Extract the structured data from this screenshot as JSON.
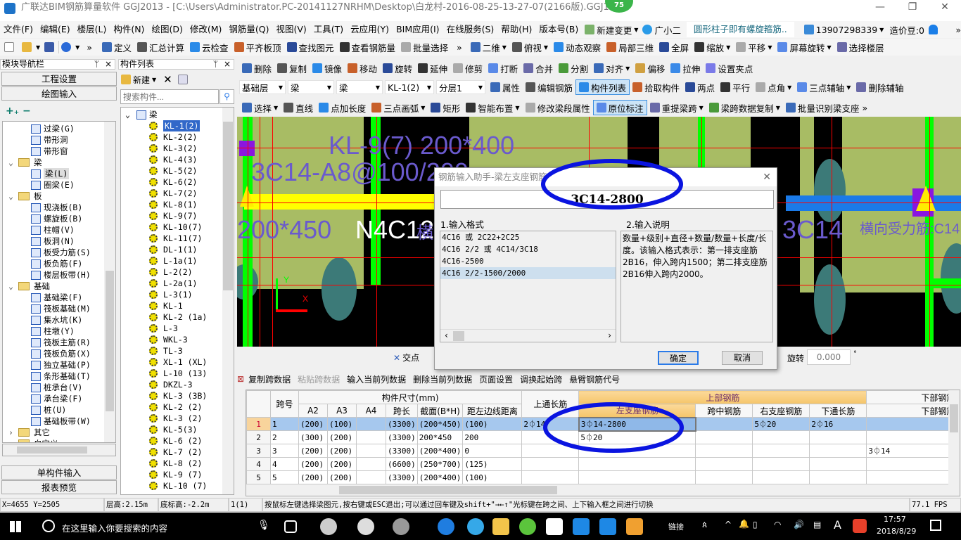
{
  "titlebar": {
    "title": "广联达BIM钢筋算量软件 GGJ2013 - [C:\\Users\\Administrator.PC-20141127NRHM\\Desktop\\白龙村-2016-08-25-13-27-07(2166版).GGJ12]",
    "badge": "75",
    "minimize": "—",
    "restore": "❐",
    "close": "✕"
  },
  "menu": {
    "items": [
      "文件(F)",
      "编辑(E)",
      "楼层(L)",
      "构件(N)",
      "绘图(D)",
      "修改(M)",
      "钢筋量(Q)",
      "视图(V)",
      "工具(T)",
      "云应用(Y)",
      "BIM应用(I)",
      "在线服务(S)",
      "帮助(H)",
      "版本号(B)"
    ],
    "new_change": "新建变更",
    "assistant": "广小二",
    "news": "圆形柱子即有螺旋箍筋..",
    "account": "13907298339",
    "beans": "造价豆:0",
    "more": "»"
  },
  "toolbar1": {
    "items": [
      "定义",
      "汇总计算",
      "云检查",
      "平齐板顶",
      "查找图元",
      "查看钢筋量",
      "批量选择"
    ],
    "more": "»",
    "right": [
      "二维",
      "俯视",
      "动态观察",
      "局部三维",
      "全屏",
      "缩放",
      "平移",
      "屏幕旋转",
      "选择楼层"
    ]
  },
  "toolbar2": {
    "items": [
      "删除",
      "复制",
      "镜像",
      "移动",
      "旋转",
      "延伸",
      "修剪",
      "打断",
      "合并",
      "分割",
      "对齐",
      "偏移",
      "拉伸",
      "设置夹点"
    ]
  },
  "toolbar3": {
    "floor": "基础层",
    "type1": "梁",
    "type2": "梁",
    "component": "KL-1(2)",
    "layer": "分层1",
    "items": [
      "属性",
      "编辑钢筋",
      "构件列表",
      "拾取构件",
      "两点",
      "平行",
      "点角",
      "三点辅轴",
      "删除辅轴"
    ]
  },
  "toolbar4": {
    "items": [
      "选择",
      "直线",
      "点加长度",
      "三点画弧",
      "矩形",
      "智能布置",
      "修改梁段属性",
      "原位标注",
      "重提梁跨",
      "梁跨数据复制",
      "批量识别梁支座"
    ],
    "more": "»"
  },
  "nav_panel": {
    "title": "模块导航栏",
    "pin": "ᛘ",
    "close": "×",
    "project_settings": "工程设置",
    "draw_input": "绘图输入",
    "single_input": "单构件输入",
    "report_preview": "报表预览",
    "tree": [
      {
        "label": "过梁(G)",
        "level": 2
      },
      {
        "label": "带形洞",
        "level": 2
      },
      {
        "label": "带形窗",
        "level": 2
      },
      {
        "label": "梁",
        "level": 1
      },
      {
        "label": "梁(L)",
        "level": 2,
        "highlight": true
      },
      {
        "label": "圈梁(E)",
        "level": 2
      },
      {
        "label": "板",
        "level": 1
      },
      {
        "label": "现浇板(B)",
        "level": 2
      },
      {
        "label": "螺旋板(B)",
        "level": 2
      },
      {
        "label": "柱帽(V)",
        "level": 2
      },
      {
        "label": "板洞(N)",
        "level": 2
      },
      {
        "label": "板受力筋(S)",
        "level": 2
      },
      {
        "label": "板负筋(F)",
        "level": 2
      },
      {
        "label": "楼层板带(H)",
        "level": 2
      },
      {
        "label": "基础",
        "level": 1
      },
      {
        "label": "基础梁(F)",
        "level": 2
      },
      {
        "label": "筏板基础(M)",
        "level": 2
      },
      {
        "label": "集水坑(K)",
        "level": 2
      },
      {
        "label": "柱墩(Y)",
        "level": 2
      },
      {
        "label": "筏板主筋(R)",
        "level": 2
      },
      {
        "label": "筏板负筋(X)",
        "level": 2
      },
      {
        "label": "独立基础(P)",
        "level": 2
      },
      {
        "label": "条形基础(T)",
        "level": 2
      },
      {
        "label": "桩承台(V)",
        "level": 2
      },
      {
        "label": "承台梁(F)",
        "level": 2
      },
      {
        "label": "桩(U)",
        "level": 2
      },
      {
        "label": "基础板带(W)",
        "level": 2
      },
      {
        "label": "其它",
        "level": 1,
        "collapsed": true
      },
      {
        "label": "自定义",
        "level": 1
      }
    ]
  },
  "component_panel": {
    "title": "构件列表",
    "pin": "ᛘ",
    "close": "×",
    "new": "新建",
    "search_placeholder": "搜索构件...",
    "root": "梁",
    "items": [
      "KL-1(2)",
      "KL-2(2)",
      "KL-3(2)",
      "KL-4(3)",
      "KL-5(2)",
      "KL-6(2)",
      "KL-7(2)",
      "KL-8(1)",
      "KL-9(7)",
      "KL-10(7)",
      "KL-11(7)",
      "DL-1(1)",
      "L-1a(1)",
      "L-2(2)",
      "L-2a(1)",
      "L-3(1)",
      "KL-1",
      "KL-2 (1a)",
      "L-3",
      "WKL-3",
      "TL-3",
      "XL-1 (XL)",
      "L-10 (13)",
      "DKZL-3",
      "KL-3 (3B)",
      "KL-2 (2)",
      "KL-3 (2)",
      "KL-5(3)",
      "KL-6 (2)",
      "KL-7 (2)",
      "KL-8 (2)",
      "KL-9 (7)",
      "KL-10 (7)"
    ],
    "selected": 0
  },
  "canvas": {
    "texts": [
      "KL-9(7)  200*400",
      "3C14-A8@100/200",
      "200*450",
      "N4C12",
      "横",
      "3C14",
      "横向受力筋:C14",
      "X",
      "Y"
    ]
  },
  "dialog": {
    "title": "钢筋输入助手-梁左支座钢筋",
    "close": "✕",
    "input_value": "3C14-2800",
    "format_label": "1.输入格式",
    "desc_label": "2.输入说明",
    "formats": [
      "4C16 或 2C22+2C25",
      "4C16 2/2 或 4C14/3C18",
      "4C16-2500",
      "4C16 2/2-1500/2000"
    ],
    "selected_format": 3,
    "description": "数量+级别+直径+数量/数量+长度/长度。该输入格式表示：第一排支座筋2B16，伸入跨内1500；第二排支座筋2B16伸入跨内2000。",
    "ok": "确定",
    "cancel": "取消"
  },
  "snapbar": {
    "intersection": "交点",
    "rotate": "旋转",
    "rotate_value": "0.000",
    "degree": "°"
  },
  "grid_toolbar": {
    "items": [
      "复制跨数据",
      "粘贴跨数据",
      "输入当前列数据",
      "删除当前列数据",
      "页面设置",
      "调换起始跨",
      "悬臂钢筋代号"
    ]
  },
  "grid": {
    "group_headers": {
      "span": "跨号",
      "size": "构件尺寸(mm)",
      "top_long": "上通长筋",
      "top": "上部钢筋",
      "bottom": "下部钢筋"
    },
    "sub_headers": [
      "A2",
      "A3",
      "A4",
      "跨长",
      "截面(B*H)",
      "距左边线距离",
      "左支座钢筋",
      "跨中钢筋",
      "右支座钢筋",
      "下通长筋",
      "下部钢筋"
    ],
    "rows": [
      [
        "1",
        "1",
        "(200)",
        "(100)",
        "",
        "(3300)",
        "(200*450)",
        "(100)",
        "2⏀14",
        "3⏀14-2800",
        "",
        "5⏀20",
        "2⏀16",
        ""
      ],
      [
        "2",
        "2",
        "(300)",
        "(200)",
        "",
        "(3300)",
        "200*450",
        "200",
        "",
        "5⏀20",
        "",
        "",
        "",
        ""
      ],
      [
        "3",
        "3",
        "(200)",
        "(200)",
        "",
        "(3300)",
        "(200*400)",
        "0",
        "",
        "",
        "",
        "",
        "",
        "3⏀14"
      ],
      [
        "4",
        "4",
        "(200)",
        "(200)",
        "",
        "(6600)",
        "(250*700)",
        "(125)",
        "",
        "",
        "",
        "",
        "",
        ""
      ],
      [
        "5",
        "5",
        "(200)",
        "(200)",
        "",
        "(3300)",
        "(200*400)",
        "(100)",
        "",
        "",
        "",
        "",
        "",
        ""
      ]
    ],
    "selected_row": 0
  },
  "statusbar": {
    "coords": "X=4655 Y=2505",
    "floor_height": "层高:2.15m",
    "bottom_elev": "底标高:-2.2m",
    "span": "1(1)",
    "hint": "按鼠标左键选择梁图元,按右键或ESC退出;可以通过回车键及shift+\"→←↑\"光标键在跨之间、上下输入框之间进行切换",
    "fps": "77.1 FPS"
  },
  "taskbar": {
    "search_placeholder": "在这里输入你要搜索的内容",
    "links": "链接",
    "ime": "A",
    "time": "17:57",
    "date": "2018/8/29"
  },
  "colors": {
    "annotation": "#0a14e0",
    "canvas_bg": "#000000",
    "slab": "#a8bc64",
    "column": "#3c7a78",
    "beam_green": "#00ff00",
    "grid_red": "#ff0000",
    "selected": "#3168c9"
  }
}
